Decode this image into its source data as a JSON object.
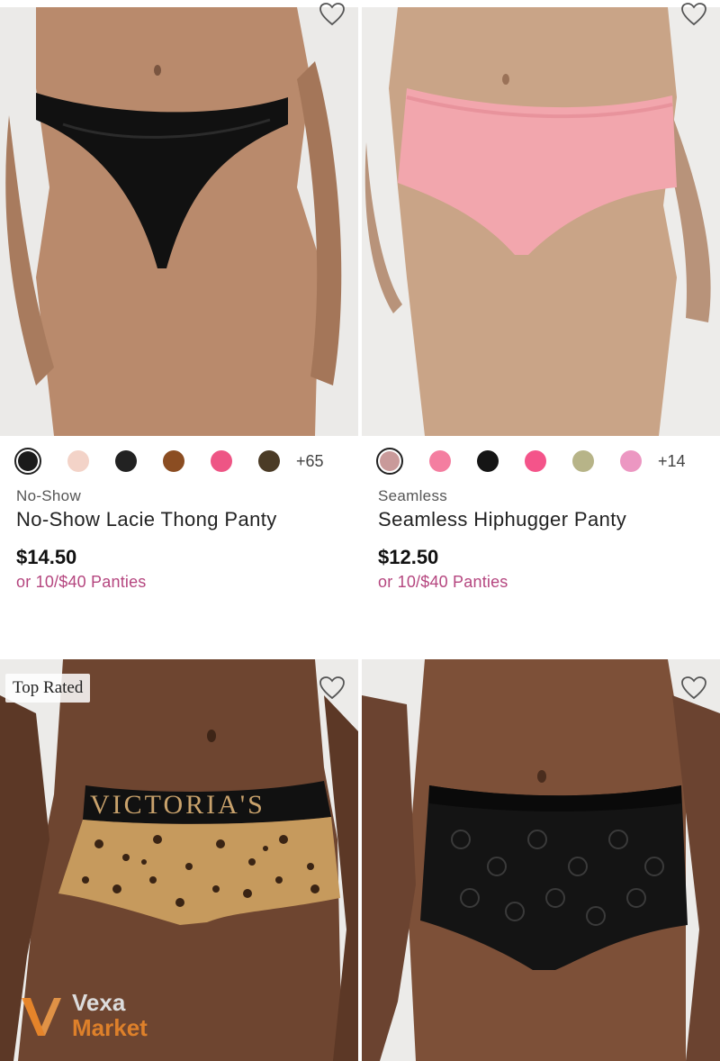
{
  "products": [
    {
      "category": "No-Show",
      "name": "No-Show Lacie Thong Panty",
      "price": "$14.50",
      "promo": "or 10/$40 Panties",
      "swatch_colors": [
        "#1b1b1b",
        "#f3d3c8",
        "#222222",
        "#8b4d22",
        "#ee5585",
        "#4b3b26"
      ],
      "more_colors": "+65",
      "wishlist_icon": "heart-outline-icon",
      "image": "model wearing black lace thong"
    },
    {
      "category": "Seamless",
      "name": "Seamless Hiphugger Panty",
      "price": "$12.50",
      "promo": "or 10/$40 Panties",
      "swatch_colors": [
        "#c99a9a",
        "#f47ea0",
        "#151515",
        "#f4548a",
        "#b7b488",
        "#ec97c2"
      ],
      "more_colors": "+14",
      "wishlist_icon": "heart-outline-icon",
      "image": "model wearing pink seamless hiphugger"
    },
    {
      "badge": "Top Rated",
      "wishlist_icon": "heart-outline-icon",
      "waistband_text": "VICTORIA'S",
      "image": "model wearing leopard print boyshort"
    },
    {
      "wishlist_icon": "heart-outline-icon",
      "image": "model wearing black lace hiphugger"
    }
  ],
  "watermark": {
    "line1": "Vexa",
    "line2": "Market"
  },
  "colors": {
    "promo": "#b5467f",
    "selected_border": "#222222"
  }
}
